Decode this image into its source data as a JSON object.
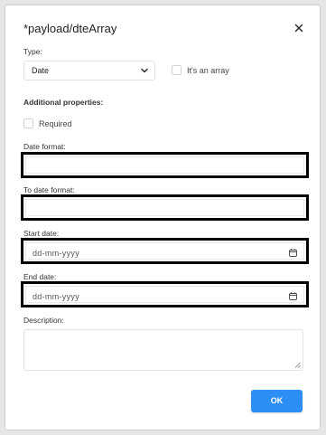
{
  "dialog": {
    "title": "*payload/dteArray",
    "close_icon": "close-icon"
  },
  "type_field": {
    "label": "Type:",
    "value": "Date",
    "array_checkbox_label": "It's an array",
    "array_checked": false
  },
  "additional": {
    "heading": "Additional properties:",
    "required_label": "Required",
    "required_checked": false
  },
  "date_format": {
    "label": "Date format:",
    "value": ""
  },
  "to_date_format": {
    "label": "To date format:",
    "value": ""
  },
  "start_date": {
    "label": "Start date:",
    "placeholder": "dd-mm-yyyy"
  },
  "end_date": {
    "label": "End date:",
    "placeholder": "dd-mm-yyyy"
  },
  "description": {
    "label": "Description:",
    "value": ""
  },
  "actions": {
    "ok_label": "OK",
    "ok_color": "#2d8ef5"
  }
}
